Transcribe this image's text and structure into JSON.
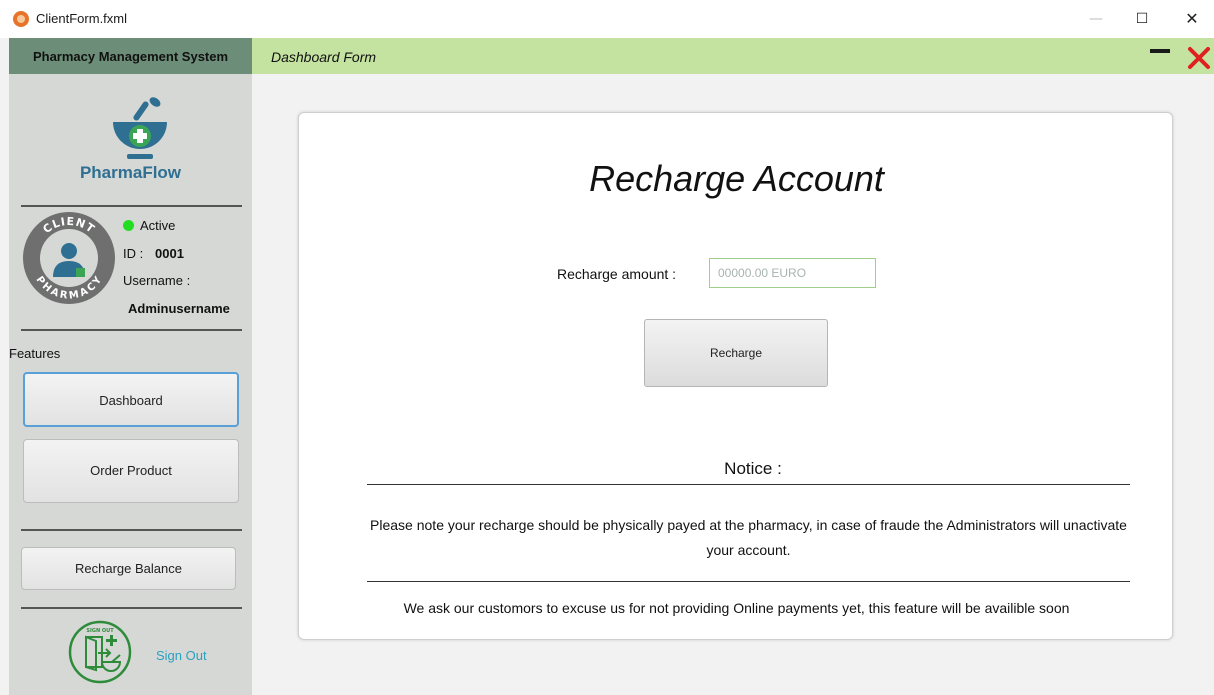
{
  "window": {
    "title": "ClientForm.fxml",
    "min_glyph": "—",
    "max_glyph": "☐",
    "close_glyph": "✕"
  },
  "sidebar": {
    "header": "Pharmacy Management System",
    "brand": "PharmaFlow",
    "badge": {
      "top_text": "CLIENT",
      "bottom_text": "PHARMACY"
    },
    "status": "Active",
    "id_label": "ID :",
    "id_value": "0001",
    "username_label": "Username :",
    "username_value": "Adminusername",
    "features_label": "Features",
    "items": [
      {
        "label": "Dashboard",
        "active": true
      },
      {
        "label": "Order Product",
        "active": false
      }
    ],
    "recharge_label": "Recharge Balance",
    "signout_badge": "SIGN OUT",
    "signout_label": "Sign Out"
  },
  "header": {
    "title": "Dashboard Form"
  },
  "main": {
    "title": "Recharge Account",
    "amount_label": "Recharge amount :",
    "amount_placeholder": "00000.00 EURO",
    "recharge_button": "Recharge",
    "notice_title": "Notice :",
    "notice_text": "Please note your recharge should be physically payed at the pharmacy, in case of fraude the Administrators will unactivate your account.",
    "footer_note": "We ask our customors to excuse us for not providing Online payments yet, this feature will be availible soon"
  },
  "colors": {
    "sidebar_header": "#6c8e78",
    "main_header": "#c4e2a0",
    "brand": "#2f6f91",
    "status_active": "#22dd22",
    "close_red": "#e02020",
    "link": "#2a9fc0",
    "signout_green": "#2e8b3a"
  }
}
